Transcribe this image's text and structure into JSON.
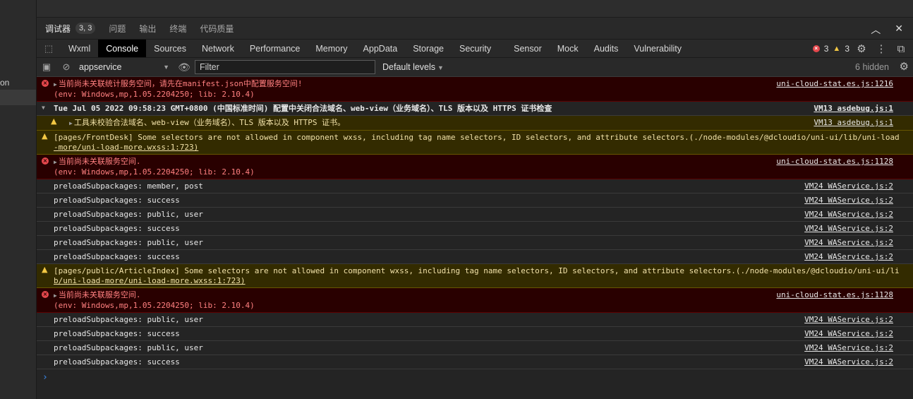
{
  "sidebar": {
    "partial_text": "on"
  },
  "panel_tabs": {
    "items": [
      {
        "label": "调试器",
        "badge": "3, 3",
        "active": true
      },
      {
        "label": "问题"
      },
      {
        "label": "输出"
      },
      {
        "label": "终端"
      },
      {
        "label": "代码质量"
      }
    ],
    "collapse_glyph": "︿",
    "close_glyph": "✕"
  },
  "devtools_tabs": {
    "items": [
      "Wxml",
      "Console",
      "Sources",
      "Network",
      "Performance",
      "Memory",
      "AppData",
      "Storage",
      "Security",
      "Sensor",
      "Mock",
      "Audits",
      "Vulnerability"
    ],
    "active": "Console",
    "error_count": "3",
    "warning_count": "3"
  },
  "filter_bar": {
    "context": "appservice",
    "filter_placeholder": "Filter",
    "levels": "Default levels",
    "hidden": "6 hidden"
  },
  "messages": [
    {
      "level": "error",
      "lines": [
        "当前尚未关联统计服务空间，请先在manifest.json中配置服务空间!",
        "(env: Windows,mp,1.05.2204250; lib: 2.10.4)"
      ],
      "source": "uni-cloud-stat.es.js:1216"
    },
    {
      "level": "group",
      "lines": [
        "Tue Jul 05 2022 09:58:23 GMT+0800 (中国标准时间) 配置中关闭合法域名、web-view（业务域名）、TLS 版本以及 HTTPS 证书检查"
      ],
      "source": "VM13 asdebug.js:1"
    },
    {
      "level": "warning-nested",
      "lines": [
        "工具未校验合法域名、web-view（业务域名）、TLS 版本以及 HTTPS 证书。"
      ],
      "source": "VM13 asdebug.js:1"
    },
    {
      "level": "warning",
      "lines": [
        "[pages/FrontDesk] Some selectors are not allowed in component wxss, including tag name selectors, ID selectors, and attribute selectors.(./node-modules/@dcloudio/uni-ui/lib/uni-load",
        "-more/uni-load-more.wxss:1:723)"
      ],
      "source": ""
    },
    {
      "level": "error",
      "lines": [
        "当前尚未关联服务空间.",
        "(env: Windows,mp,1.05.2204250; lib: 2.10.4)"
      ],
      "source": "uni-cloud-stat.es.js:1128"
    },
    {
      "level": "info",
      "lines": [
        "preloadSubpackages: member, post"
      ],
      "source": "VM24 WAService.js:2"
    },
    {
      "level": "info",
      "lines": [
        "preloadSubpackages: success"
      ],
      "source": "VM24 WAService.js:2"
    },
    {
      "level": "info",
      "lines": [
        "preloadSubpackages: public, user"
      ],
      "source": "VM24 WAService.js:2"
    },
    {
      "level": "info",
      "lines": [
        "preloadSubpackages: success"
      ],
      "source": "VM24 WAService.js:2"
    },
    {
      "level": "info",
      "lines": [
        "preloadSubpackages: public, user"
      ],
      "source": "VM24 WAService.js:2"
    },
    {
      "level": "info",
      "lines": [
        "preloadSubpackages: success"
      ],
      "source": "VM24 WAService.js:2"
    },
    {
      "level": "warning",
      "lines": [
        "[pages/public/ArticleIndex] Some selectors are not allowed in component wxss, including tag name selectors, ID selectors, and attribute selectors.(./node-modules/@dcloudio/uni-ui/li",
        "b/uni-load-more/uni-load-more.wxss:1:723)"
      ],
      "source": ""
    },
    {
      "level": "error",
      "lines": [
        "当前尚未关联服务空间.",
        "(env: Windows,mp,1.05.2204250; lib: 2.10.4)"
      ],
      "source": "uni-cloud-stat.es.js:1128"
    },
    {
      "level": "info",
      "lines": [
        "preloadSubpackages: public, user"
      ],
      "source": "VM24 WAService.js:2"
    },
    {
      "level": "info",
      "lines": [
        "preloadSubpackages: success"
      ],
      "source": "VM24 WAService.js:2"
    },
    {
      "level": "info",
      "lines": [
        "preloadSubpackages: public, user"
      ],
      "source": "VM24 WAService.js:2"
    },
    {
      "level": "info",
      "lines": [
        "preloadSubpackages: success"
      ],
      "source": "VM24 WAService.js:2"
    }
  ],
  "prompt_glyph": "›"
}
